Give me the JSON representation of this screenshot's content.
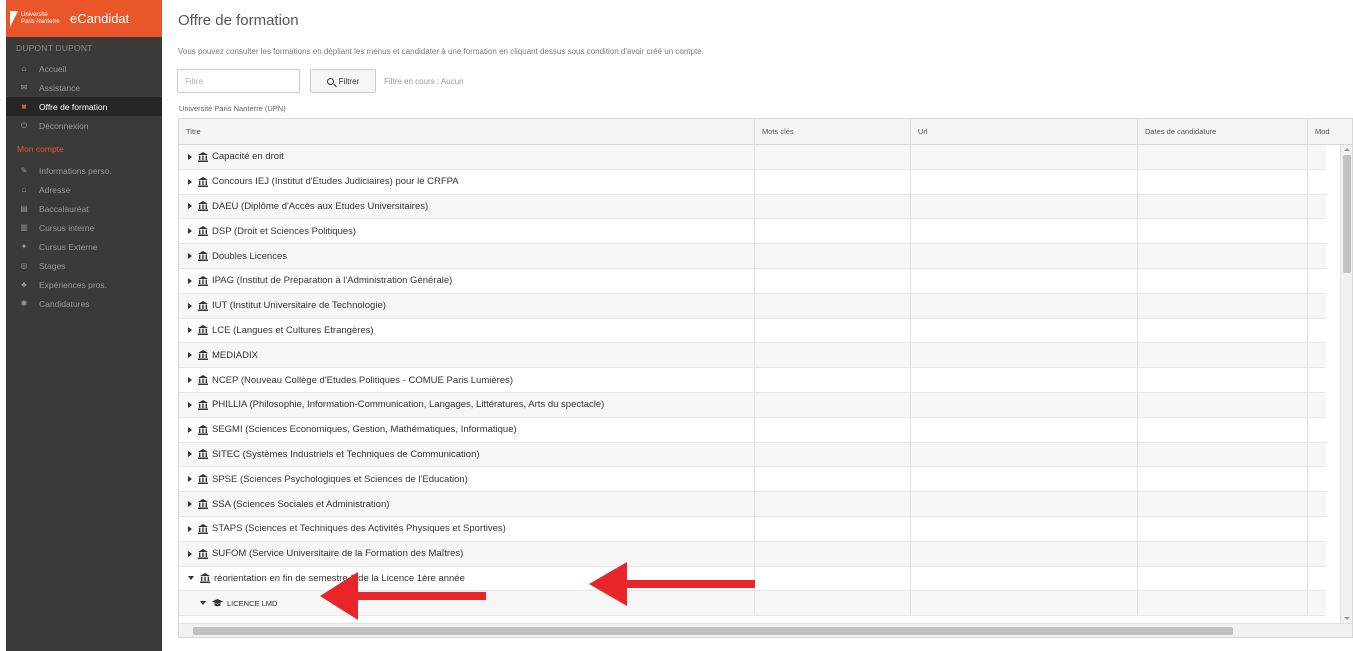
{
  "app": {
    "logo_line1": "Université",
    "logo_line2": "Paris Nanterre",
    "name": "eCandidat"
  },
  "sidebar": {
    "user": "DUPONT DUPONT",
    "items": [
      {
        "label": "Accueil",
        "icon": "home-icon",
        "glyph": "⌂"
      },
      {
        "label": "Assistance",
        "icon": "support-icon",
        "glyph": "✉"
      },
      {
        "label": "Offre de formation",
        "icon": "offer-icon",
        "glyph": "■"
      },
      {
        "label": "Déconnexion",
        "icon": "power-icon",
        "glyph": "⏻"
      }
    ],
    "section_title": "Mon compte",
    "account_items": [
      {
        "label": "Informations perso.",
        "icon": "pencil-icon",
        "glyph": "✎"
      },
      {
        "label": "Adresse",
        "icon": "home-icon",
        "glyph": "⌂"
      },
      {
        "label": "Baccalauréat",
        "icon": "diploma-icon",
        "glyph": "▤"
      },
      {
        "label": "Cursus interne",
        "icon": "bank-icon",
        "glyph": "▥"
      },
      {
        "label": "Cursus Externe",
        "icon": "graduation-icon",
        "glyph": "✦"
      },
      {
        "label": "Stages",
        "icon": "eye-icon",
        "glyph": "◎"
      },
      {
        "label": "Expériences pros.",
        "icon": "users-icon",
        "glyph": "♣"
      },
      {
        "label": "Candidatures",
        "icon": "star-icon",
        "glyph": "✱"
      }
    ]
  },
  "main": {
    "title": "Offre de formation",
    "intro": "Vous pouvez consulter les formations en dépliant les menus et candidater à une formation en cliquant dessus sous condition d'avoir créé un compte.",
    "filter_placeholder": "Filtre",
    "filter_button": "Filtrer",
    "filter_status": "Filtre en cours : Aucun",
    "org": "Université Paris Nanterre (UPN)"
  },
  "table": {
    "columns": [
      "Titre",
      "Mots clés",
      "Url",
      "Dates de candidature",
      "Mod"
    ],
    "rows": [
      "Capacité en droit",
      "Concours IEJ (Institut d'Etudes Judiciaires) pour le CRFPA",
      "DAEU (Diplôme d'Accès aux Etudes Universitaires)",
      "DSP (Droit et Sciences Politiques)",
      "Doubles Licences",
      "IPAG (Institut de Préparation à l'Administration Générale)",
      "IUT (Institut Universitaire de Technologie)",
      "LCE (Langues et Cultures Etrangères)",
      "MEDIADIX",
      "NCEP (Nouveau Collège d'Etudes Politiques - COMUE Paris Lumières)",
      "PHILLIA (Philosophie, Information-Communication, Langages, Littératures, Arts du spectacle)",
      "SEGMI (Sciences Economiques, Gestion, Mathématiques, Informatique)",
      "SITEC (Systèmes Industriels et Techniques de Communication)",
      "SPSE (Sciences Psychologiques et Sciences de l'Education)",
      "SSA (Sciences Sociales et Administration)",
      "STAPS (Sciences et Techniques des Activités Physiques et Sportives)",
      "SUFOM (Service Universitaire de la Formation des Maîtres)"
    ],
    "expanded_row": "réorientation en fin de semestre 1 de la Licence 1ère année",
    "sub_row": "LICENCE LMD"
  },
  "colors": {
    "brand": "#e8562a",
    "sidebar": "#3a3a3a",
    "arrow": "#e8262a"
  }
}
